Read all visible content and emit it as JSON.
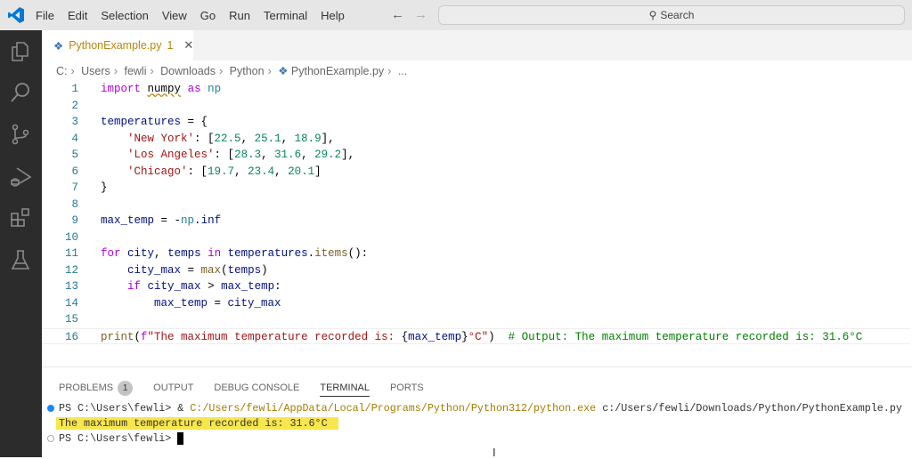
{
  "menu": [
    "File",
    "Edit",
    "Selection",
    "View",
    "Go",
    "Run",
    "Terminal",
    "Help"
  ],
  "search": {
    "label": "Search"
  },
  "tab": {
    "filename": "PythonExample.py",
    "problems": "1"
  },
  "breadcrumbs": [
    "C:",
    "Users",
    "fewli",
    "Downloads",
    "Python",
    "PythonExample.py",
    "..."
  ],
  "code": [
    [
      [
        "kw",
        "import"
      ],
      [
        "pl",
        " "
      ],
      [
        "squig",
        "numpy"
      ],
      [
        "pl",
        " "
      ],
      [
        "kw",
        "as"
      ],
      [
        "pl",
        " "
      ],
      [
        "mod",
        "np"
      ]
    ],
    [],
    [
      [
        "var",
        "temperatures"
      ],
      [
        "pl",
        " = {"
      ]
    ],
    [
      [
        "pl",
        "    "
      ],
      [
        "str",
        "'New York'"
      ],
      [
        "pl",
        ": ["
      ],
      [
        "num",
        "22.5"
      ],
      [
        "pl",
        ", "
      ],
      [
        "num",
        "25.1"
      ],
      [
        "pl",
        ", "
      ],
      [
        "num",
        "18.9"
      ],
      [
        "pl",
        "],"
      ]
    ],
    [
      [
        "pl",
        "    "
      ],
      [
        "str",
        "'Los Angeles'"
      ],
      [
        "pl",
        ": ["
      ],
      [
        "num",
        "28.3"
      ],
      [
        "pl",
        ", "
      ],
      [
        "num",
        "31.6"
      ],
      [
        "pl",
        ", "
      ],
      [
        "num",
        "29.2"
      ],
      [
        "pl",
        "],"
      ]
    ],
    [
      [
        "pl",
        "    "
      ],
      [
        "str",
        "'Chicago'"
      ],
      [
        "pl",
        ": ["
      ],
      [
        "num",
        "19.7"
      ],
      [
        "pl",
        ", "
      ],
      [
        "num",
        "23.4"
      ],
      [
        "pl",
        ", "
      ],
      [
        "num",
        "20.1"
      ],
      [
        "pl",
        "]"
      ]
    ],
    [
      [
        "pl",
        "}"
      ]
    ],
    [],
    [
      [
        "var",
        "max_temp"
      ],
      [
        "pl",
        " = -"
      ],
      [
        "mod",
        "np"
      ],
      [
        "pl",
        "."
      ],
      [
        "var",
        "inf"
      ]
    ],
    [],
    [
      [
        "kw",
        "for"
      ],
      [
        "pl",
        " "
      ],
      [
        "var",
        "city"
      ],
      [
        "pl",
        ", "
      ],
      [
        "var",
        "temps"
      ],
      [
        "pl",
        " "
      ],
      [
        "kw",
        "in"
      ],
      [
        "pl",
        " "
      ],
      [
        "var",
        "temperatures"
      ],
      [
        "pl",
        "."
      ],
      [
        "fn",
        "items"
      ],
      [
        "pl",
        "():"
      ]
    ],
    [
      [
        "pl",
        "    "
      ],
      [
        "var",
        "city_max"
      ],
      [
        "pl",
        " = "
      ],
      [
        "fn",
        "max"
      ],
      [
        "pl",
        "("
      ],
      [
        "var",
        "temps"
      ],
      [
        "pl",
        ")"
      ]
    ],
    [
      [
        "pl",
        "    "
      ],
      [
        "kw",
        "if"
      ],
      [
        "pl",
        " "
      ],
      [
        "var",
        "city_max"
      ],
      [
        "pl",
        " > "
      ],
      [
        "var",
        "max_temp"
      ],
      [
        "pl",
        ":"
      ]
    ],
    [
      [
        "pl",
        "        "
      ],
      [
        "var",
        "max_temp"
      ],
      [
        "pl",
        " = "
      ],
      [
        "var",
        "city_max"
      ]
    ],
    [],
    [
      [
        "fn",
        "print"
      ],
      [
        "pl",
        "("
      ],
      [
        "kw",
        "f"
      ],
      [
        "str",
        "\"The maximum temperature recorded is: "
      ],
      [
        "pl",
        "{"
      ],
      [
        "var",
        "max_temp"
      ],
      [
        "pl",
        "}"
      ],
      [
        "str",
        "°C\""
      ],
      [
        "pl",
        ")  "
      ],
      [
        "cm",
        "# Output: The maximum temperature recorded is: 31.6°C"
      ]
    ]
  ],
  "panel": {
    "tabs": [
      "PROBLEMS",
      "OUTPUT",
      "DEBUG CONSOLE",
      "TERMINAL",
      "PORTS"
    ],
    "problems_count": "1",
    "active": "TERMINAL"
  },
  "terminal": {
    "line1_prompt": "PS C:\\Users\\fewli> & ",
    "line1_path": "C:/Users/fewli/AppData/Local/Programs/Python/Python312/python.exe",
    "line1_arg": " c:/Users/fewli/Downloads/Python/PythonExample.py",
    "output": "The maximum temperature recorded is: 31.6°C",
    "prompt": "PS C:\\Users\\fewli> "
  },
  "colors": {
    "accent": "#007acc",
    "highlight": "#f7e64c"
  }
}
